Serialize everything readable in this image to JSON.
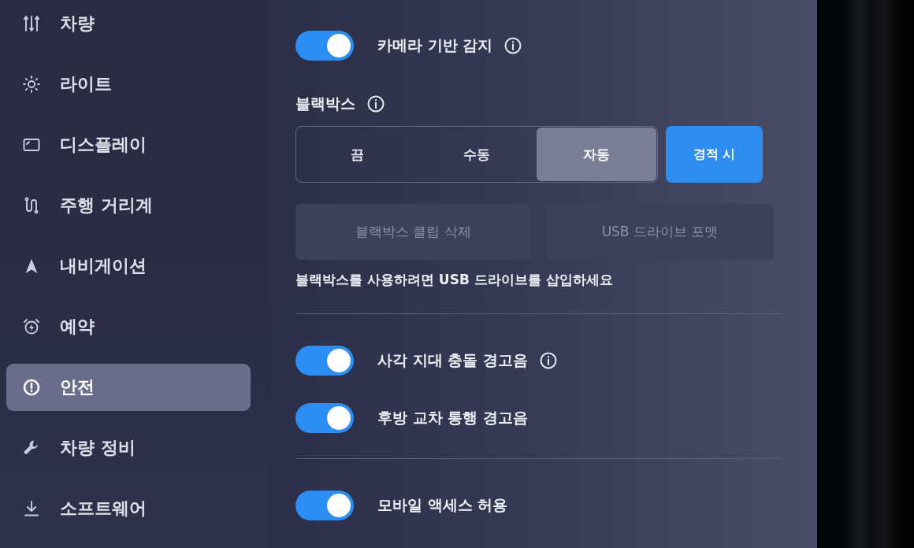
{
  "sidebar": {
    "items": [
      {
        "label": "차량",
        "selected": false
      },
      {
        "label": "라이트",
        "selected": false
      },
      {
        "label": "디스플레이",
        "selected": false
      },
      {
        "label": "주행 거리계",
        "selected": false
      },
      {
        "label": "내비게이션",
        "selected": false
      },
      {
        "label": "예약",
        "selected": false
      },
      {
        "label": "안전",
        "selected": true
      },
      {
        "label": "차량 정비",
        "selected": false
      },
      {
        "label": "소프트웨어",
        "selected": false
      }
    ]
  },
  "settings": [
    {
      "kind": "toggle",
      "label": "카메라 기반 감지",
      "on": true,
      "info": true
    },
    {
      "kind": "heading",
      "label": "블랙박스",
      "info": true
    },
    {
      "kind": "segmented",
      "options": [
        {
          "label": "끔",
          "selected": false
        },
        {
          "label": "수동",
          "selected": false
        },
        {
          "label": "자동",
          "selected": true
        }
      ],
      "extra": {
        "label": "경적 시",
        "on": true
      }
    },
    {
      "kind": "actions",
      "buttons": [
        {
          "label": "블랙박스 클립 삭제",
          "disabled": true
        },
        {
          "label": "USB 드라이브 포맷",
          "disabled": true
        }
      ]
    },
    {
      "kind": "note",
      "text": "블랙박스를 사용하려면 USB 드라이브를 삽입하세요"
    },
    {
      "kind": "divider"
    },
    {
      "kind": "toggle",
      "label": "사각 지대 충돌 경고음",
      "on": true,
      "info": true
    },
    {
      "kind": "toggle",
      "label": "후방 교차 통행 경고음",
      "on": true,
      "info": false
    },
    {
      "kind": "divider"
    },
    {
      "kind": "toggle",
      "label": "모바일 액세스 허용",
      "on": true,
      "info": false
    }
  ]
}
